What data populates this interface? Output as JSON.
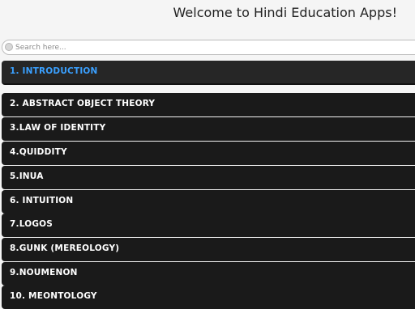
{
  "header": {
    "title": "Welcome to Hindi Education Apps!"
  },
  "search": {
    "placeholder": "Search here..."
  },
  "menu": {
    "items": [
      {
        "label": "1. INTRODUCTION"
      },
      {
        "label": "2. ABSTRACT OBJECT THEORY"
      },
      {
        "label": "3.LAW OF IDENTITY"
      },
      {
        "label": "4.QUIDDITY"
      },
      {
        "label": "5.INUA"
      },
      {
        "label": "6. INTUITION"
      },
      {
        "label": "7.LOGOS"
      },
      {
        "label": "8.GUNK (MEREOLOGY)"
      },
      {
        "label": "9.NOUMENON"
      },
      {
        "label": "10. MEONTOLOGY"
      }
    ],
    "active_color": "#3aa0ff",
    "item_bg": "#1a1a1a"
  }
}
